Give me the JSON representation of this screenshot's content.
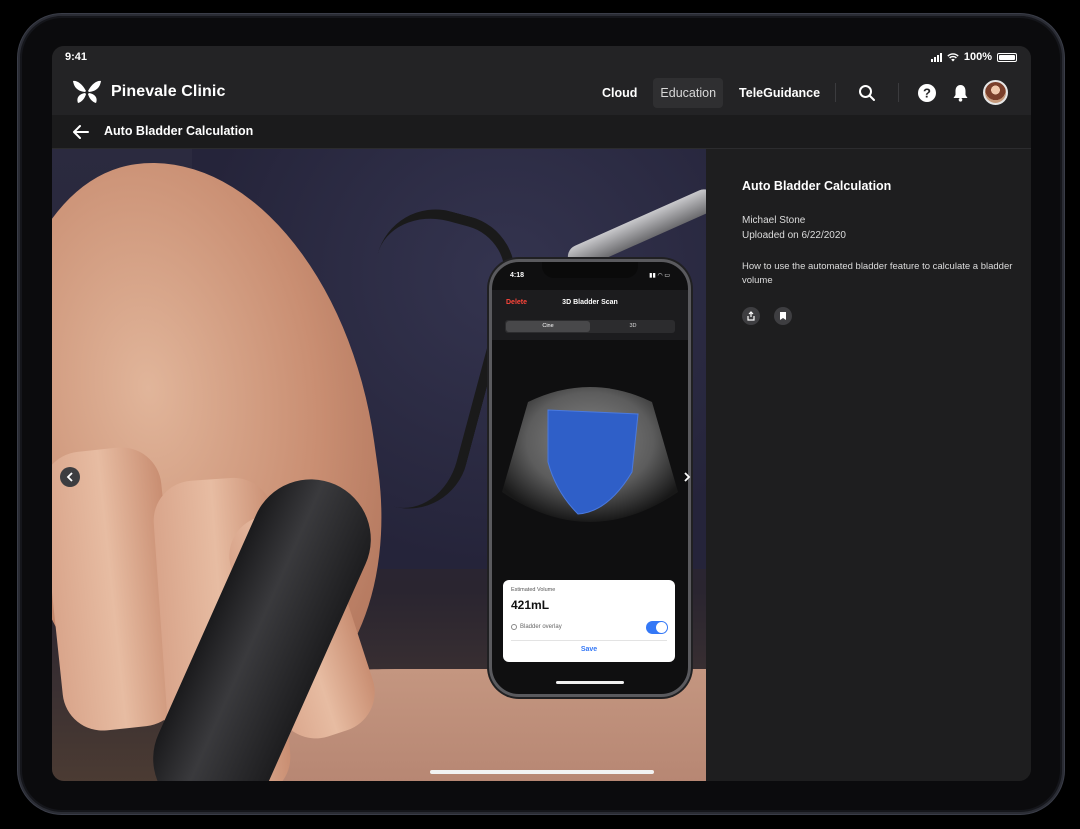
{
  "status_bar": {
    "time": "9:41",
    "battery": "100%",
    "battery_level": 1.0
  },
  "nav": {
    "brand": "Pinevale Clinic",
    "links": [
      {
        "label": "Cloud",
        "active": false
      },
      {
        "label": "Education",
        "active": true
      },
      {
        "label": "TeleGuidance",
        "active": false
      }
    ],
    "icons": [
      "search-icon",
      "help-icon",
      "bell-icon",
      "avatar"
    ]
  },
  "subheader": {
    "title": "Auto Bladder Calculation"
  },
  "phone": {
    "time": "4:18",
    "delete": "Delete",
    "title": "3D Bladder Scan",
    "segments": [
      "Cine",
      "3D"
    ],
    "active_segment": "Cine",
    "card": {
      "label": "Estimated Volume",
      "volume": "421mL",
      "overlay_label": "Bladder overlay",
      "overlay_on": true,
      "save": "Save"
    }
  },
  "info": {
    "title": "Auto Bladder Calculation",
    "author": "Michael Stone",
    "uploaded": "Uploaded on 6/22/2020",
    "description": "How to use the automated bladder feature to calculate a bladder volume",
    "actions": [
      "share-icon",
      "bookmark-icon"
    ]
  },
  "colors": {
    "accent_blue": "#3478f6",
    "delete_red": "#ff453a",
    "bladder_overlay": "#2f5fc8"
  }
}
